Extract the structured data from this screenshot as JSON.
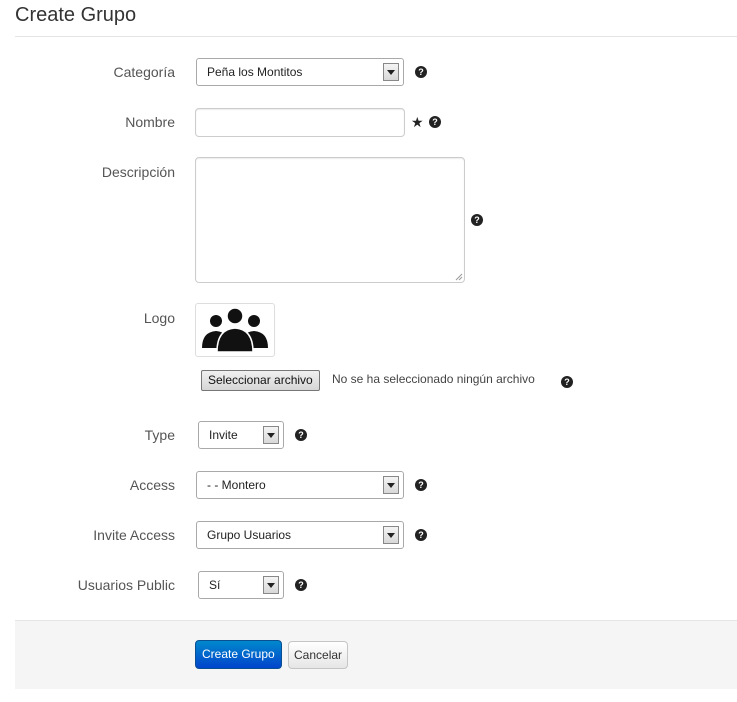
{
  "page": {
    "title": "Create Grupo"
  },
  "form": {
    "categoria": {
      "label": "Categoría",
      "value": "Peña los Montitos",
      "help": "?"
    },
    "nombre": {
      "label": "Nombre",
      "value": "",
      "required_mark": "★",
      "help": "?"
    },
    "descripcion": {
      "label": "Descripción",
      "value": "",
      "help": "?"
    },
    "logo": {
      "label": "Logo",
      "image_icon": "group-people-icon",
      "file_button": "Seleccionar archivo",
      "file_status": "No se ha seleccionado ningún archivo",
      "help": "?"
    },
    "type": {
      "label": "Type",
      "value": "Invite",
      "help": "?"
    },
    "access": {
      "label": "Access",
      "value": "- - Montero",
      "help": "?"
    },
    "invite_access": {
      "label": "Invite Access",
      "value": "Grupo Usuarios",
      "help": "?"
    },
    "usuarios_public": {
      "label": "Usuarios Public",
      "value": "Sí",
      "help": "?"
    }
  },
  "actions": {
    "submit_label": "Create Grupo",
    "cancel_label": "Cancelar"
  },
  "colors": {
    "primary": "#0055cc",
    "footer_bg": "#f5f5f5"
  }
}
